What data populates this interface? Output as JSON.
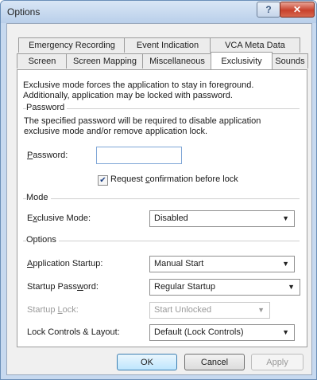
{
  "window": {
    "title": "Options",
    "help_glyph": "?",
    "close_glyph": "✕"
  },
  "tabs": {
    "row1": [
      "Emergency Recording",
      "Event Indication",
      "VCA Meta Data"
    ],
    "row2": [
      "Screen",
      "Screen Mapping",
      "Miscellaneous",
      "Exclusivity",
      "Sounds"
    ],
    "active": "Exclusivity"
  },
  "intro": {
    "line1": "Exclusive mode forces the application to stay in foreground.",
    "line2": "Additionally, application may be locked with password."
  },
  "password_group": {
    "title": "Password",
    "desc1": "The specified password will be required to disable application",
    "desc2": "exclusive mode and/or remove application lock.",
    "label": "Password:",
    "value": "",
    "confirm_label": "Request confirmation before lock",
    "confirm_checked": true,
    "check_glyph": "✔"
  },
  "mode_group": {
    "title": "Mode",
    "exclusive_label": "Exclusive Mode:",
    "exclusive_value": "Disabled"
  },
  "options_group": {
    "title": "Options",
    "startup_label": "Application Startup:",
    "startup_value": "Manual Start",
    "startup_password_label": "Startup Password:",
    "startup_password_value": "Regular Startup",
    "startup_lock_label": "Startup Lock:",
    "startup_lock_value": "Start Unlocked",
    "lock_controls_label": "Lock Controls & Layout:",
    "lock_controls_value": "Default (Lock Controls)"
  },
  "buttons": {
    "ok": "OK",
    "cancel": "Cancel",
    "apply": "Apply"
  },
  "icons": {
    "dropdown": "chevron-down-icon",
    "arrow_glyph": "▼"
  }
}
